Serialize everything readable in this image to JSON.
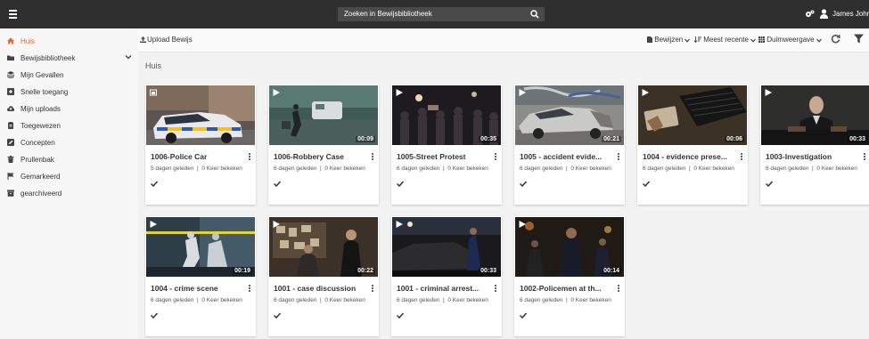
{
  "search": {
    "placeholder": "Zoeken in Bewijsbibliotheek"
  },
  "user": {
    "name": "James Johns"
  },
  "sidebar": {
    "items": [
      {
        "label": "Huis"
      },
      {
        "label": "Bewijsbibliotheek"
      },
      {
        "label": "Mijn Gevallen"
      },
      {
        "label": "Snelle toegang"
      },
      {
        "label": "Mijn uploads"
      },
      {
        "label": "Toegewezen"
      },
      {
        "label": "Concepten"
      },
      {
        "label": "Prullenbak"
      },
      {
        "label": "Gemarkeerd"
      },
      {
        "label": "gearchiveerd"
      }
    ]
  },
  "toolbar": {
    "upload_label": "Upload Bewijs",
    "evidence_label": "Bewijzen",
    "sort_label": "Meest recente",
    "view_label": "Duimweergave"
  },
  "breadcrumb": "Huis",
  "colors": {
    "accent": "#e8622c",
    "topbar": "#2f2f2f"
  },
  "cards": [
    {
      "title": "1006-Police Car",
      "age": "5 dagen geleden",
      "views": "0 Keer bekeken",
      "duration": "",
      "type": "image"
    },
    {
      "title": "1006-Robbery Case",
      "age": "6 dagen geleden",
      "views": "0 Keer bekeken",
      "duration": "00:09",
      "type": "video"
    },
    {
      "title": "1005-Street Protest",
      "age": "6 dagen geleden",
      "views": "0 Keer bekeken",
      "duration": "00:35",
      "type": "video"
    },
    {
      "title": "1005 - accident evide...",
      "age": "6 dagen geleden",
      "views": "0 Keer bekeken",
      "duration": "00:21",
      "type": "video"
    },
    {
      "title": "1004 - evidence prese...",
      "age": "6 dagen geleden",
      "views": "0 Keer bekeken",
      "duration": "00:06",
      "type": "video"
    },
    {
      "title": "1003-Investigation",
      "age": "6 dagen geleden",
      "views": "0 Keer bekeken",
      "duration": "00:33",
      "type": "video"
    },
    {
      "title": "1004 - crime scene",
      "age": "6 dagen geleden",
      "views": "0 Keer bekeken",
      "duration": "00:19",
      "type": "video"
    },
    {
      "title": "1001 - case discussion",
      "age": "6 dagen geleden",
      "views": "0 Keer bekeken",
      "duration": "00:22",
      "type": "video"
    },
    {
      "title": "1001 - criminal arrest...",
      "age": "6 dagen geleden",
      "views": "0 Keer bekeken",
      "duration": "00:33",
      "type": "video"
    },
    {
      "title": "1002-Policemen at th...",
      "age": "6 dagen geleden",
      "views": "0 Keer bekeken",
      "duration": "00:14",
      "type": "video"
    }
  ]
}
